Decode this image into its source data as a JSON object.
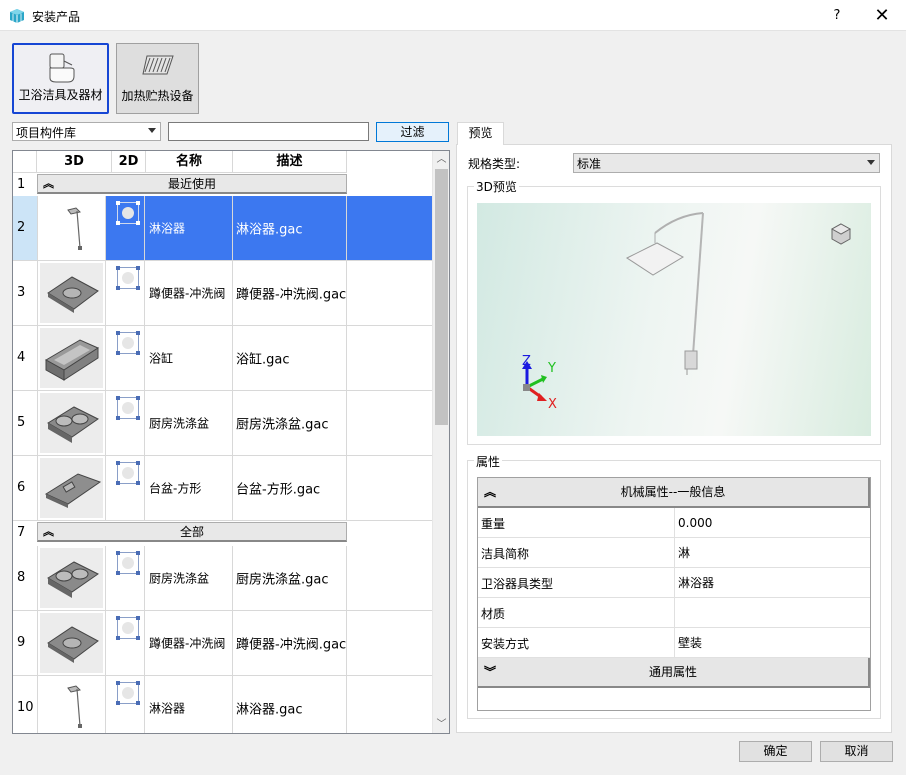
{
  "window": {
    "title": "安装产品",
    "help": "?",
    "close": "✕"
  },
  "categories": [
    {
      "label": "卫浴洁具及器材",
      "active": true
    },
    {
      "label": "加热贮热设备",
      "active": false
    }
  ],
  "library": {
    "selected": "项目构件库",
    "filter_value": "",
    "filter_button": "过滤"
  },
  "table": {
    "columns": [
      "3D",
      "2D",
      "名称",
      "描述"
    ],
    "groups": {
      "recent": "最近使用",
      "all": "全部"
    },
    "rows": [
      {
        "num": "2",
        "name": "淋浴器",
        "desc": "淋浴器.gac",
        "selected": true
      },
      {
        "num": "3",
        "name": "蹲便器-冲洗阀",
        "desc": "蹲便器-冲洗阀.gac"
      },
      {
        "num": "4",
        "name": "浴缸",
        "desc": "浴缸.gac"
      },
      {
        "num": "5",
        "name": "厨房洗涤盆",
        "desc": "厨房洗涤盆.gac"
      },
      {
        "num": "6",
        "name": "台盆-方形",
        "desc": "台盆-方形.gac"
      },
      {
        "num": "8",
        "name": "厨房洗涤盆",
        "desc": "厨房洗涤盆.gac"
      },
      {
        "num": "9",
        "name": "蹲便器-冲洗阀",
        "desc": "蹲便器-冲洗阀.gac"
      },
      {
        "num": "10",
        "name": "淋浴器",
        "desc": "淋浴器.gac"
      }
    ],
    "group_row_nums": {
      "recent": "1",
      "all": "7"
    }
  },
  "preview": {
    "tab": "预览",
    "spec_label": "规格类型:",
    "spec_value": "标准",
    "preview_title": "3D预览",
    "axes": {
      "x": "X",
      "y": "Y",
      "z": "Z"
    }
  },
  "properties": {
    "title": "属性",
    "group1": "机械属性--一般信息",
    "rows": [
      {
        "key": "重量",
        "value": "0.000"
      },
      {
        "key": "洁具简称",
        "value": "淋"
      },
      {
        "key": "卫浴器具类型",
        "value": "淋浴器"
      },
      {
        "key": "材质",
        "value": ""
      },
      {
        "key": "安装方式",
        "value": "壁装"
      }
    ],
    "group2": "通用属性"
  },
  "buttons": {
    "ok": "确定",
    "cancel": "取消"
  },
  "colors": {
    "selection": "#3c78f0",
    "active_border": "#1646d4",
    "focus": "#0078d7"
  }
}
